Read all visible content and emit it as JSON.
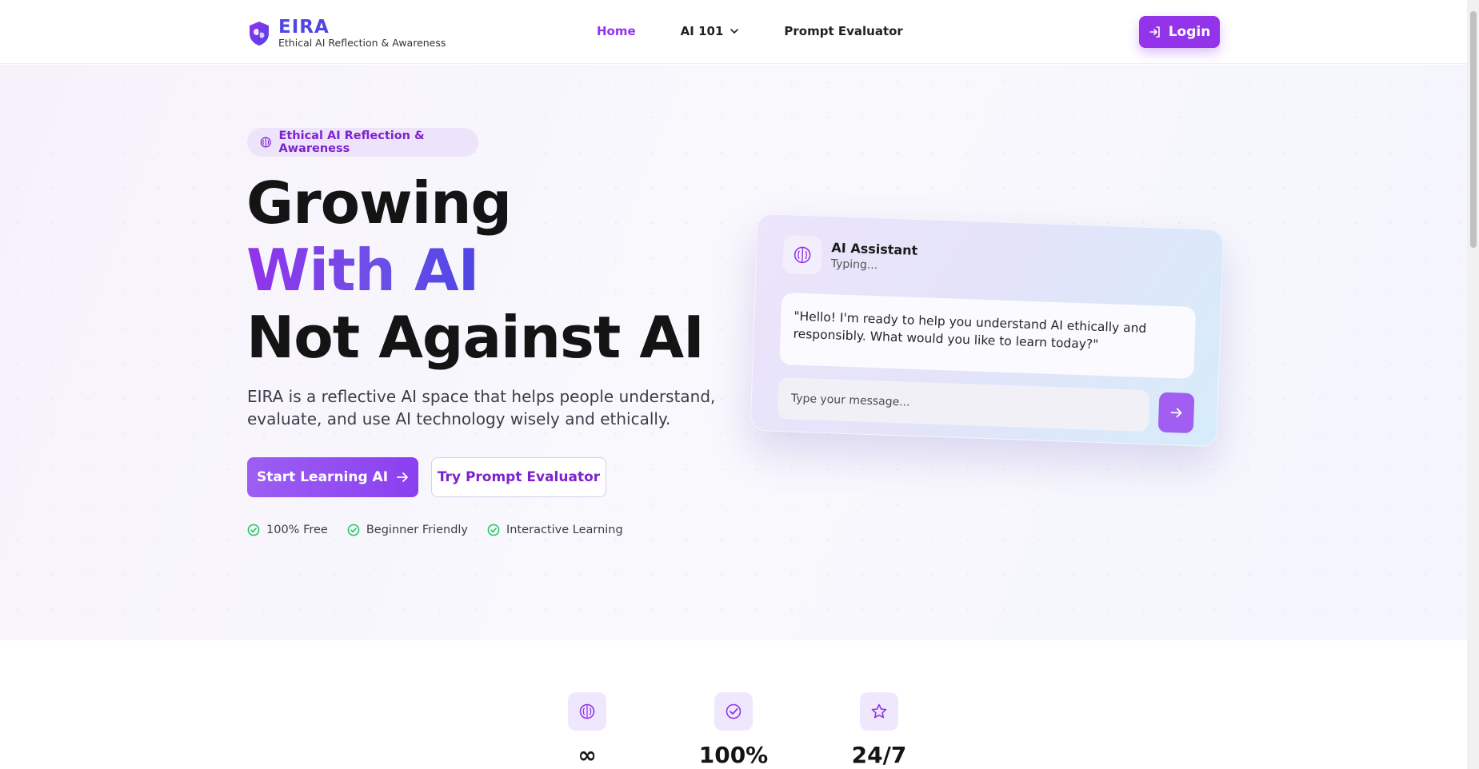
{
  "nav": {
    "logo_title": "EIRA",
    "logo_subtitle": "Ethical AI Reflection & Awareness",
    "links": [
      {
        "label": "Home",
        "active": true
      },
      {
        "label": "AI 101",
        "dropdown": true
      },
      {
        "label": "Prompt Evaluator"
      }
    ],
    "login_label": "Login"
  },
  "hero": {
    "tag": "Ethical AI Reflection & Awareness",
    "title_line1": "Growing",
    "title_line2": "With AI",
    "title_line3": "Not Against AI",
    "description": "EIRA is a reflective AI space that helps people understand, evaluate, and use AI technology wisely and ethically.",
    "primary_button": "Start Learning AI",
    "secondary_button": "Try Prompt Evaluator",
    "features": [
      "100% Free",
      "Beginner Friendly",
      "Interactive Learning"
    ]
  },
  "chat": {
    "assistant_name": "AI Assistant",
    "status": "Typing...",
    "message": "\"Hello! I'm ready to help you understand AI ethically and responsibly. What would you like to learn today?\"",
    "input_placeholder": "Type your message..."
  },
  "stats": [
    {
      "icon": "brain-icon",
      "value": "∞"
    },
    {
      "icon": "check-circle-icon",
      "value": "100%"
    },
    {
      "icon": "star-icon",
      "value": "24/7"
    }
  ],
  "colors": {
    "accent": "#9333ea",
    "accent_indigo": "#4f46e5",
    "check_green": "#22c55e"
  }
}
